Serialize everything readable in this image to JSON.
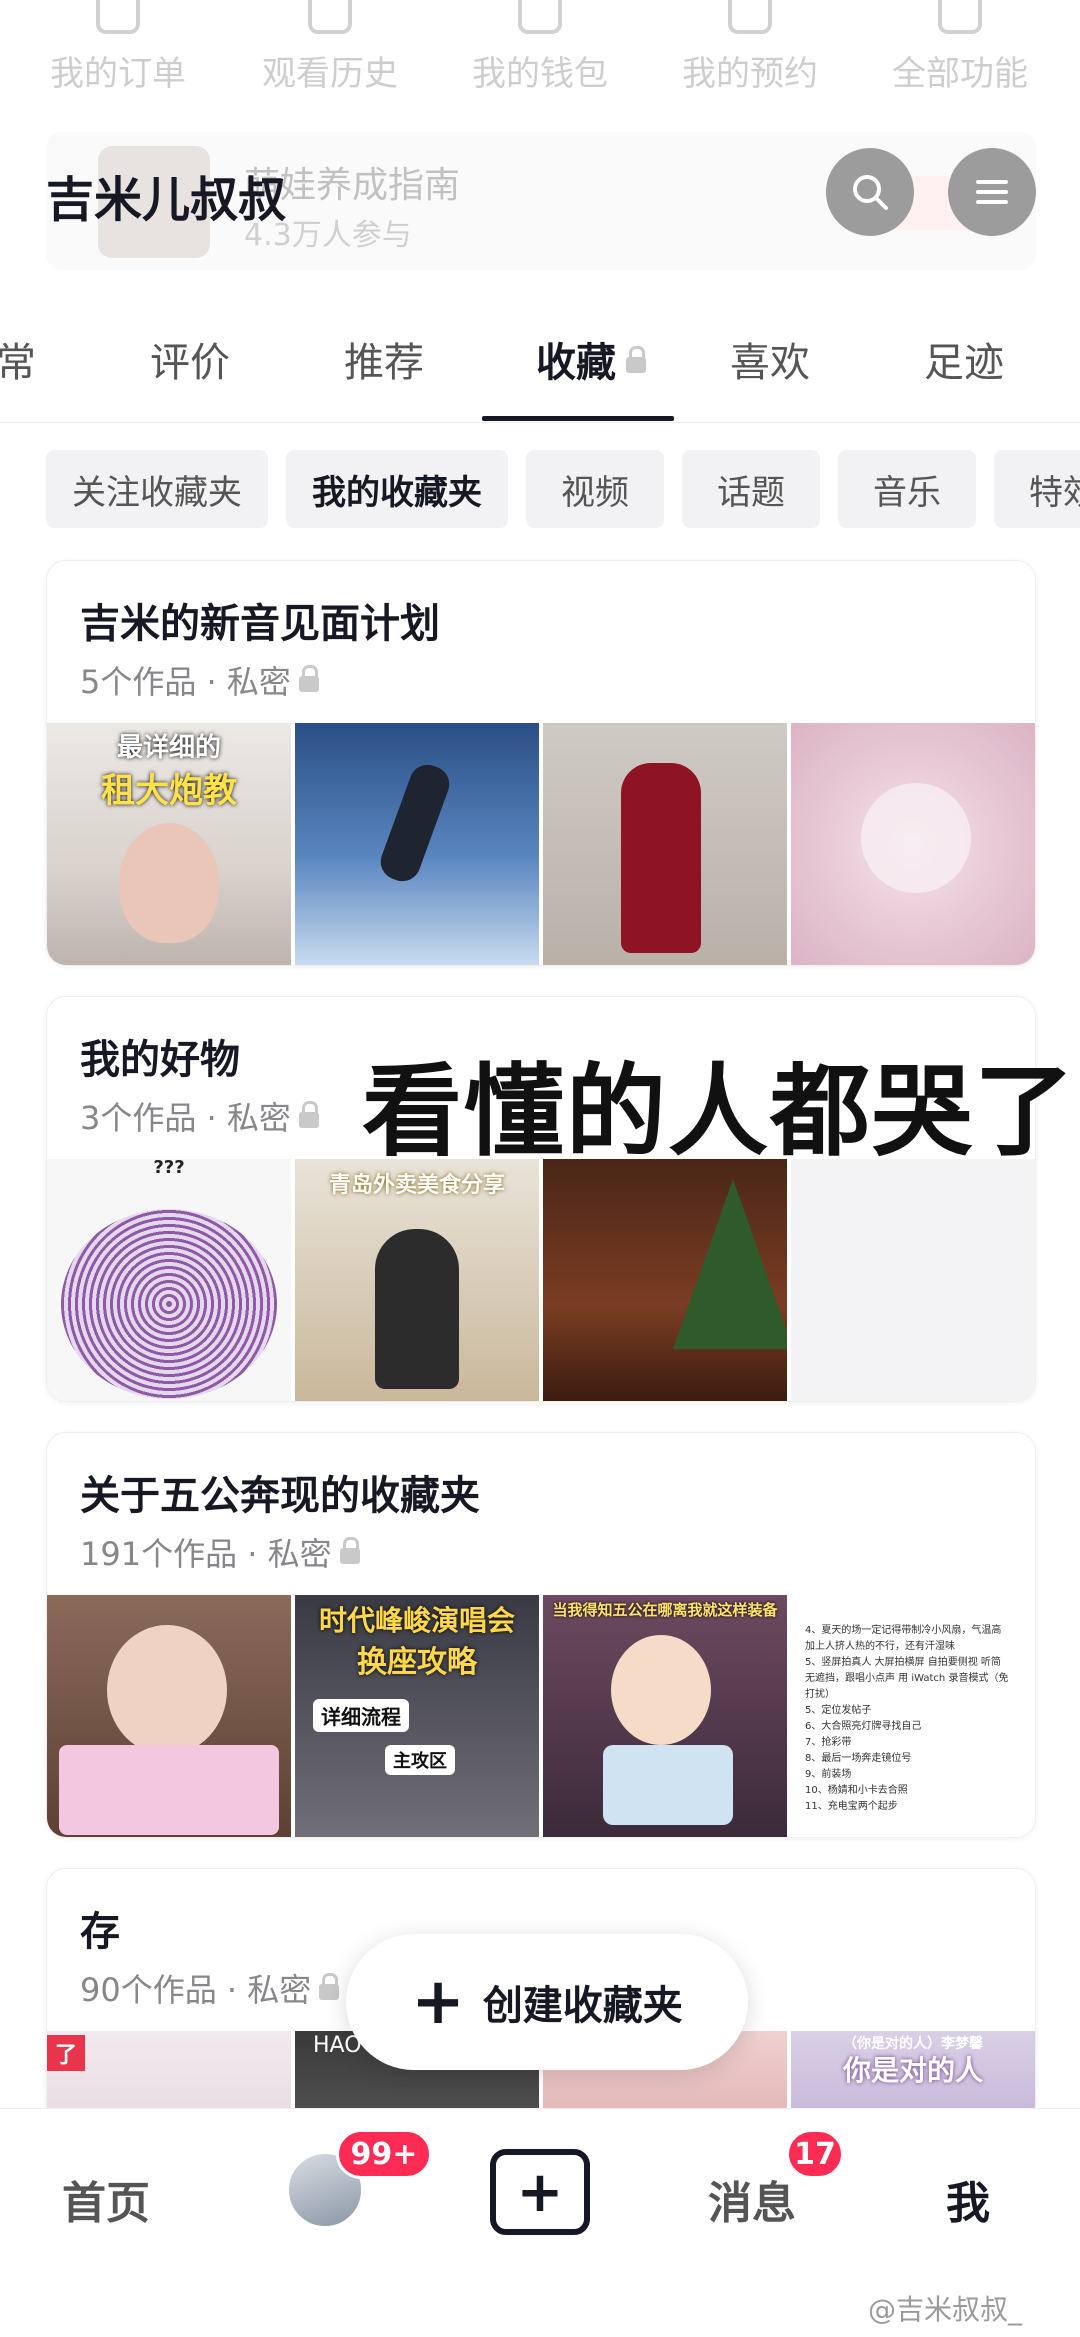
{
  "top_shortcuts": [
    "我的订单",
    "观看历史",
    "我的钱包",
    "我的预约",
    "全部功能"
  ],
  "banner": {
    "title": "萌娃养成指南",
    "subtitle": "4.3万人参与"
  },
  "profile": {
    "name": "吉米儿叔叔"
  },
  "tabs": [
    "常",
    "评价",
    "推荐",
    "收藏",
    "喜欢",
    "足迹"
  ],
  "active_tab": "收藏",
  "chips": [
    "关注收藏夹",
    "我的收藏夹",
    "视频",
    "话题",
    "音乐",
    "特效"
  ],
  "active_chip": "我的收藏夹",
  "folders": [
    {
      "title": "吉米的新音见面计划",
      "meta": "5个作品 · 私密",
      "thumbs": [
        {
          "caption": "最详细的",
          "caption2": "租大炮教"
        },
        {
          "caption": "",
          "caption2": ""
        },
        {
          "caption": "",
          "caption2": ""
        },
        {
          "caption": "",
          "caption2": ""
        }
      ]
    },
    {
      "title": "我的好物",
      "meta": "3个作品 · 私密",
      "thumbs": [
        {
          "caption": "???",
          "caption2": ""
        },
        {
          "caption": "青岛外卖美食分享",
          "caption2": ""
        },
        {
          "caption": "",
          "caption2": ""
        }
      ]
    },
    {
      "title": "关于五公奔现的收藏夹",
      "meta": "191个作品 · 私密",
      "thumbs": [
        {
          "caption": "",
          "caption2": ""
        },
        {
          "caption": "时代峰峻演唱会",
          "caption2": "换座攻略",
          "tag1": "详细流程",
          "tag2": "主攻区"
        },
        {
          "caption": "当我得知五公在哪离我就这样装备",
          "caption2": ""
        },
        {
          "notes": [
            "4、夏天的场一定记得带制冷小风扇，气温高",
            "加上人挤人热的不行，还有汗湿味",
            "5、竖屏拍真人 大屏拍横屏 自拍要侧视 听简",
            "无遮挡，跟唱小点声 用 iWatch 录音模式（免",
            "打扰）",
            "5、定位发帖子",
            "6、大合照亮灯牌寻找自己",
            "7、抢彩带",
            "8、最后一场奔走镜位号",
            "9、前装场",
            "10、杨婧和小卡去合照",
            "11、充电宝两个起步"
          ]
        }
      ]
    },
    {
      "title": "存",
      "meta": "90个作品 · 私密",
      "thumbs": [
        {
          "caption": "了",
          "caption2": ""
        },
        {
          "caption": "HAO",
          "caption2": ""
        },
        {
          "caption": "",
          "caption2": ""
        },
        {
          "caption": "你是对的人",
          "caption2": "（你是对的人）李梦馨"
        }
      ]
    }
  ],
  "overlay_text": "看懂的人都哭了",
  "fab": {
    "label": "创建收藏夹"
  },
  "nav": {
    "home": "首页",
    "friends_badge": "99+",
    "add": "+",
    "messages": "消息",
    "messages_badge": "17",
    "me": "我"
  },
  "watermark": "@吉米叔叔_",
  "colors": {
    "accent": "#fe2c55",
    "text": "#161823",
    "chip_bg": "#f2f2f4",
    "meta": "#86878b"
  }
}
